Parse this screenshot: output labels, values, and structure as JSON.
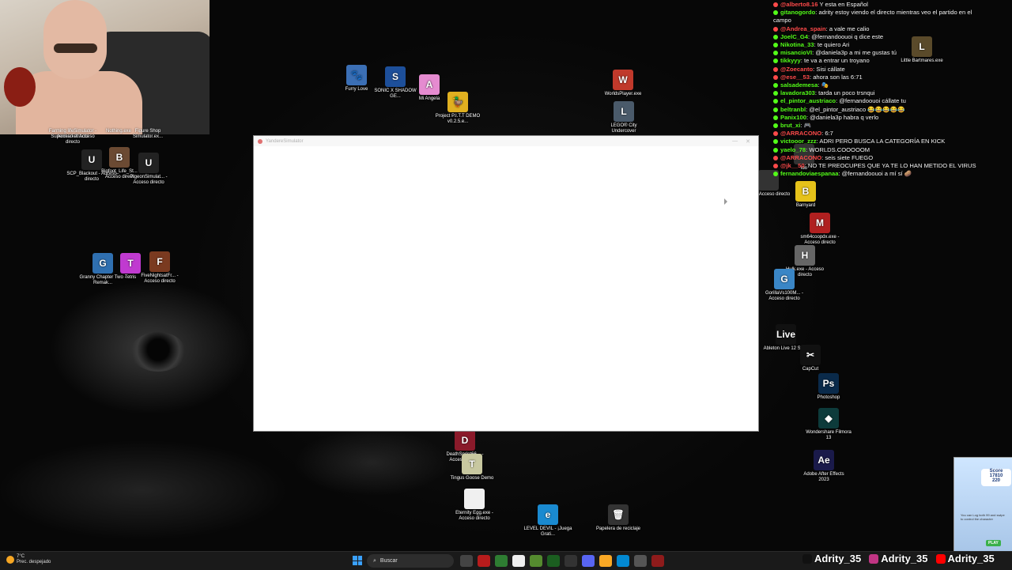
{
  "window": {
    "title": "YandereSimulator",
    "minimize": "—",
    "close": "✕"
  },
  "desktop_icons": [
    {
      "label": "Furry Love",
      "glyph": "🐾",
      "color": "#3b6fb5"
    },
    {
      "label": "SONIC X SHADOW GE...",
      "glyph": "S",
      "color": "#1d4f9a"
    },
    {
      "label": "Mi Angela",
      "glyph": "A",
      "color": "#e58bd0"
    },
    {
      "label": "Project P.I.T.T DEMO v0.2.5.e...",
      "glyph": "🦆",
      "color": "#e0b020"
    },
    {
      "label": "WorldsPlayer.exe",
      "glyph": "W",
      "color": "#c0392b"
    },
    {
      "label": "LEGO® City Undercover",
      "glyph": "L",
      "color": "#4a5a6a"
    },
    {
      "label": "Little Bartmares.exe",
      "glyph": "L",
      "color": "#5a4a2a"
    },
    {
      "label": "Farming lifeSimulator - Acceso directo",
      "glyph": "",
      "color": "#333"
    },
    {
      "label": "Nothing.exe",
      "glyph": "",
      "color": "#333"
    },
    {
      "label": "Figure Shop Simulator.ex...",
      "glyph": "",
      "color": "#333"
    },
    {
      "label": "Supermarket Acceso directo",
      "glyph": "",
      "color": "#333"
    },
    {
      "label": "SCP_Blackout - Acceso directo",
      "glyph": "U",
      "color": "#222"
    },
    {
      "label": "Bigfoot_Life_St... Acceso direct",
      "glyph": "B",
      "color": "#6b4a33"
    },
    {
      "label": "PigeonSimulat... - Acceso directo",
      "glyph": "U",
      "color": "#222"
    },
    {
      "label": "Granny Chapter Two - Remak...",
      "glyph": "G",
      "color": "#2f6fb0"
    },
    {
      "label": "Tetris",
      "glyph": "T",
      "color": "#c03ad0"
    },
    {
      "label": "FiveNightsatFr... - Acceso directo",
      "glyph": "F",
      "color": "#7a3a20"
    },
    {
      "label": "Barnyard",
      "glyph": "B",
      "color": "#e6c21a"
    },
    {
      "label": "sm64coopdx.exe - Acceso directo",
      "glyph": "M",
      "color": "#b02020"
    },
    {
      "label": "Hulk.exe - Acceso directo",
      "glyph": "H",
      "color": "#666"
    },
    {
      "label": "GorillaVs100M... - Acceso directo",
      "glyph": "G",
      "color": "#3a86c6"
    },
    {
      "label": "Ableton Live 12 Suite",
      "glyph": "Live",
      "color": "#111"
    },
    {
      "label": "CapCut",
      "glyph": "✂",
      "color": "#111"
    },
    {
      "label": "Photoshop",
      "glyph": "Ps",
      "color": "#0a2a4a"
    },
    {
      "label": "Wondershare Filmora 13",
      "glyph": "◆",
      "color": "#0d3b3b"
    },
    {
      "label": "Adobe After Effects 2023",
      "glyph": "Ae",
      "color": "#1a1a4a"
    },
    {
      "label": "DeathSprint66... - Acceso directo",
      "glyph": "D",
      "color": "#8a1a2a"
    },
    {
      "label": "Tingus Goose Demo",
      "glyph": "T",
      "color": "#c8c8a0"
    },
    {
      "label": "Eternity Egg.exe - Acceso directo",
      "glyph": "",
      "color": "#f0f0f0"
    },
    {
      "label": "LEVEL DEVIL - ¡Juega Grati...",
      "glyph": "e",
      "color": "#1a8ad0"
    },
    {
      "label": "Papelera de reciclaje",
      "glyph": "🗑",
      "color": "#333"
    },
    {
      "label": "aun - Acceso directo",
      "glyph": "",
      "color": "#333"
    },
    {
      "label": "ido",
      "glyph": "",
      "color": "#333"
    }
  ],
  "chat": [
    {
      "user": "@alberto8.16",
      "text": " Y esta en Español",
      "color": "#ff4a4a"
    },
    {
      "user": "gitanogordo",
      "text": ": adrity estoy viendo el directo mientras veo el partido en el",
      "color": "#53fc18"
    },
    {
      "user": "",
      "text": "campo",
      "color": "#53fc18"
    },
    {
      "user": "@Andrea_spain",
      "text": ": a vale me calio",
      "color": "#ff4a4a"
    },
    {
      "user": "JoelC_G4",
      "text": ": @fernandoouoi q dice este",
      "color": "#53fc18"
    },
    {
      "user": "Nikotina_33",
      "text": ": te quiero Ari",
      "color": "#53fc18"
    },
    {
      "user": "misancioVI",
      "text": ": @daniela3p a mi me gustas tú",
      "color": "#53fc18"
    },
    {
      "user": "tikkyyy",
      "text": ": te va a entrar un troyano",
      "color": "#53fc18"
    },
    {
      "user": "@Zoecanto",
      "text": ": Sisi cállate",
      "color": "#ff4a4a"
    },
    {
      "user": "@ese__53",
      "text": ": ahora son las 6:71",
      "color": "#ff4a4a"
    },
    {
      "user": "salsademesa",
      "text": ": 🎭",
      "color": "#53fc18"
    },
    {
      "user": "lavadora303",
      "text": ": tarda un poco trsnqui",
      "color": "#53fc18"
    },
    {
      "user": "el_pintor_austriaco",
      "text": ": @fernandoouoi cállate tu",
      "color": "#53fc18"
    },
    {
      "user": "beltranbl",
      "text": ": @el_pintor_austriaco 😂😂😂😂😂",
      "color": "#53fc18"
    },
    {
      "user": "Panix100",
      "text": ": @daniela3p habra q verlo",
      "color": "#53fc18"
    },
    {
      "user": "brut_xi",
      "text": ": 🎮",
      "color": "#53fc18"
    },
    {
      "user": "@ARRACONO",
      "text": ": 6:7",
      "color": "#ff4a4a"
    },
    {
      "user": "victooor_zzz",
      "text": ": ADRI PERO BUSCA LA CATEGORÍA EN KICK",
      "color": "#53fc18"
    },
    {
      "user": "yaelo_78",
      "text": ": WORLDS.COOOOOM",
      "color": "#53fc18"
    },
    {
      "user": "@ARRACONO",
      "text": ": seis siete FUEGO",
      "color": "#ff4a4a"
    },
    {
      "user": "@jk__50",
      "text": ": NO TE PREOCUPES QUE YA TE LO HAN METIDO EL VIRUS",
      "color": "#ff4a4a"
    },
    {
      "user": "fernandoviaespanaa",
      "text": ": @fernandoouoi a mí sí 🥔",
      "color": "#53fc18"
    }
  ],
  "taskbar": {
    "weather_temp": "7°C",
    "weather_desc": "Prec. despejado",
    "search_placeholder": "Buscar"
  },
  "socials": [
    {
      "handle": "Adrity_35",
      "color": "#111"
    },
    {
      "handle": "Adrity_35",
      "color": "#c13584"
    },
    {
      "handle": "Adrity_35",
      "color": "#ff0000"
    }
  ],
  "thumbnail": {
    "score_label": "Score",
    "score_value": "17810",
    "sub_value": "220",
    "hint": "You can Log both 99 and swipe to control the character",
    "play": "PLAY"
  }
}
